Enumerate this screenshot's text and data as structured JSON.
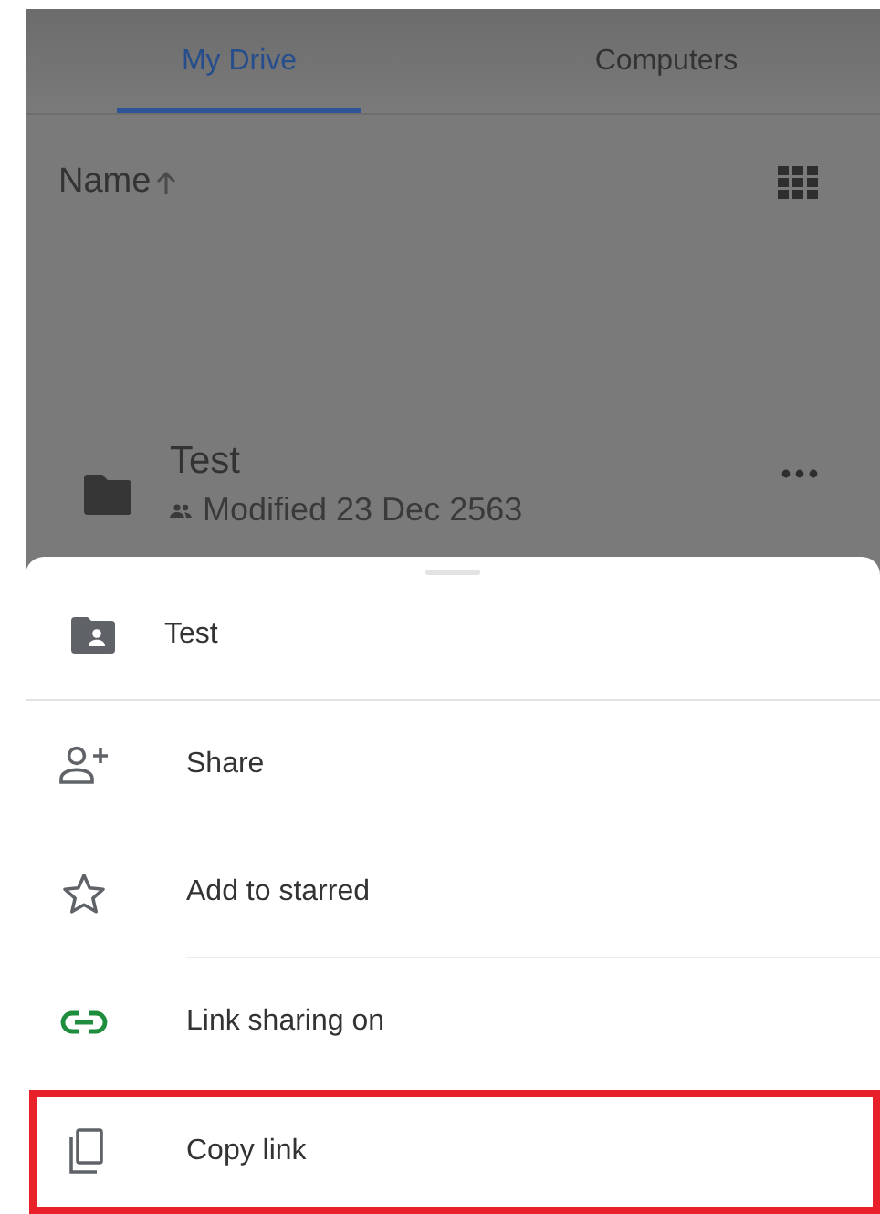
{
  "tabs": [
    {
      "label": "My Drive",
      "selected": true
    },
    {
      "label": "Computers",
      "selected": false
    }
  ],
  "sort": {
    "label": "Name"
  },
  "file": {
    "name": "Test",
    "meta": "Modified 23 Dec 2563"
  },
  "sheet": {
    "title": "Test",
    "items": [
      {
        "kind": "share",
        "label": "Share",
        "highlighted": false,
        "divider_before": false
      },
      {
        "kind": "star",
        "label": "Add to starred",
        "highlighted": false,
        "divider_before": false
      },
      {
        "kind": "link",
        "label": "Link sharing on",
        "highlighted": false,
        "divider_before": true
      },
      {
        "kind": "copy",
        "label": "Copy link",
        "highlighted": true,
        "divider_before": false
      }
    ]
  }
}
